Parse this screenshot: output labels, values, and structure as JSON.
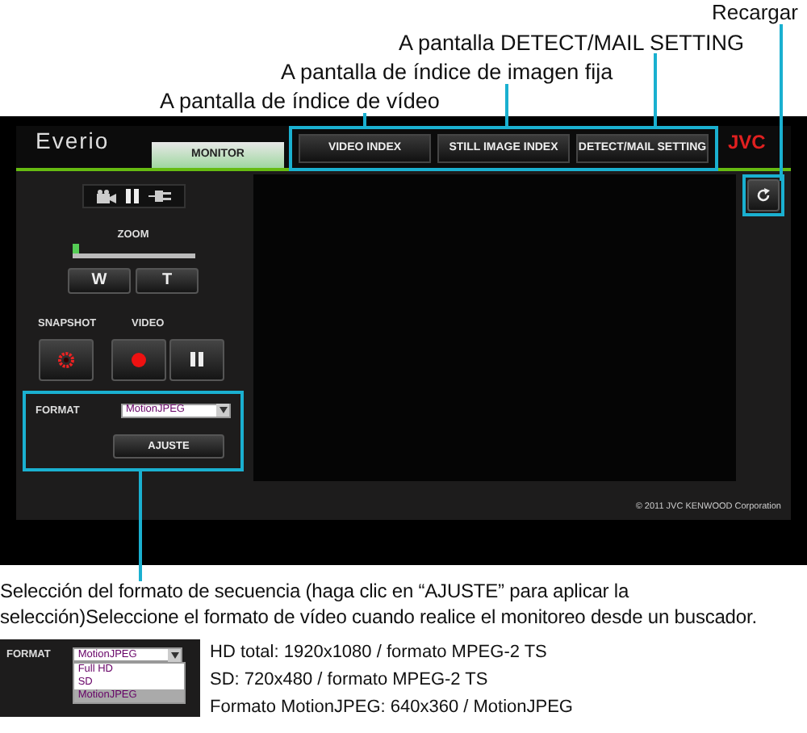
{
  "callouts": [
    {
      "text": "Recargar"
    },
    {
      "text": "A pantalla DETECT/MAIL SETTING"
    },
    {
      "text": "A pantalla de índice de imagen fija"
    },
    {
      "text": "A pantalla de índice de vídeo"
    }
  ],
  "app": {
    "logo": "Everio",
    "brand": "JVC",
    "tabs": [
      {
        "label": "MONITOR",
        "selected": true
      },
      {
        "label": "VIDEO INDEX",
        "selected": false
      },
      {
        "label": "STILL IMAGE INDEX",
        "selected": false
      },
      {
        "label": "DETECT/MAIL SETTING",
        "selected": false
      }
    ],
    "zoom": {
      "label": "ZOOM",
      "level": 0,
      "buttons": [
        "W",
        "T"
      ]
    },
    "snapshot_label": "SNAPSHOT",
    "video_label": "VIDEO",
    "format": {
      "label": "FORMAT",
      "value": "MotionJPEG",
      "button": "AJUSTE"
    },
    "copyright": "© 2011 JVC KENWOOD Corporation"
  },
  "caption": "Selección del formato de secuencia (haga clic en “AJUSTE” para aplicar la selección)Seleccione el formato de vídeo cuando realice el monitoreo desde un buscador.",
  "dropdown_example": {
    "label": "FORMAT",
    "value": "MotionJPEG",
    "options": [
      {
        "label": "Full HD",
        "selected": false
      },
      {
        "label": "SD",
        "selected": false
      },
      {
        "label": "MotionJPEG",
        "selected": true
      }
    ]
  },
  "format_notes": [
    "HD total: 1920x1080 / formato MPEG-2 TS",
    "SD: 720x480 / formato MPEG-2 TS",
    "Formato MotionJPEG: 640x360 / MotionJPEG"
  ]
}
